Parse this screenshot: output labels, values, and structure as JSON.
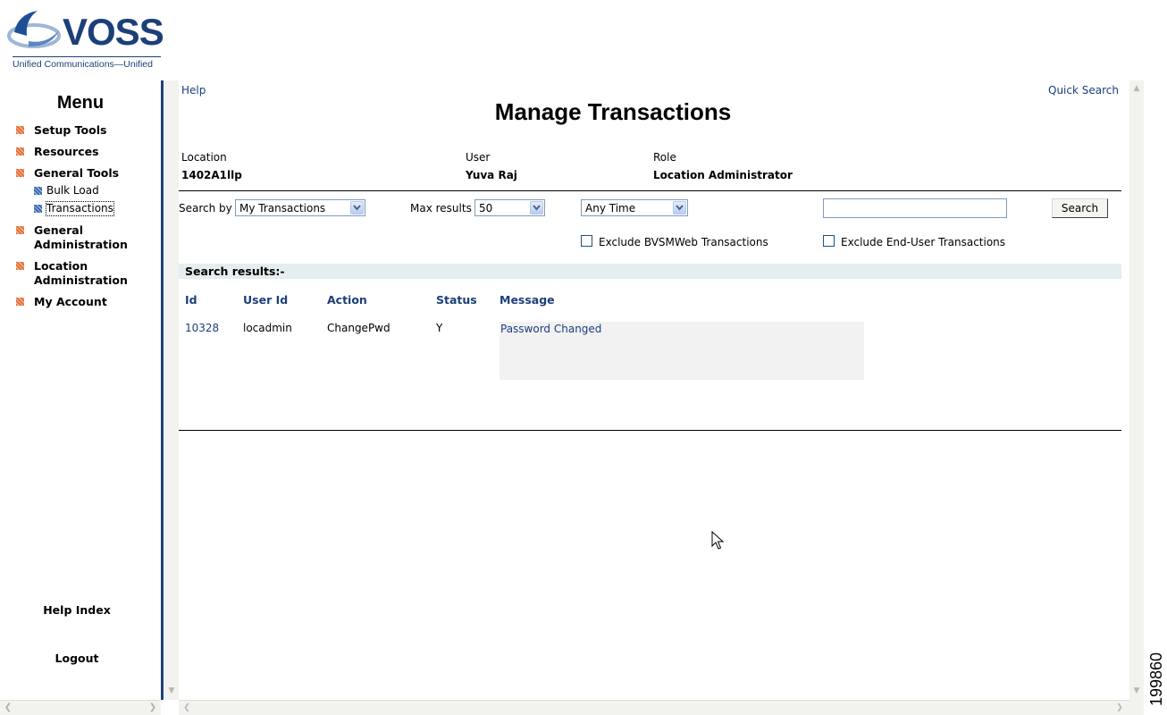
{
  "logo": {
    "brand": "VOSS",
    "tagline": "Unified Communications—Unified"
  },
  "menu": {
    "title": "Menu",
    "items": [
      {
        "label": "Setup Tools"
      },
      {
        "label": "Resources"
      },
      {
        "label": "General Tools"
      },
      {
        "label": "General Administration"
      },
      {
        "label": "Location Administration"
      },
      {
        "label": "My Account"
      }
    ],
    "subitems": [
      {
        "label": "Bulk Load"
      },
      {
        "label": "Transactions"
      }
    ],
    "help_index": "Help Index",
    "logout": "Logout"
  },
  "header": {
    "help": "Help",
    "quick_search": "Quick Search",
    "title": "Manage Transactions"
  },
  "info": {
    "location_label": "Location",
    "location_value": "1402A1llp",
    "user_label": "User",
    "user_value": "Yuva Raj",
    "role_label": "Role",
    "role_value": "Location Administrator"
  },
  "search": {
    "search_by_label": "Search by",
    "search_by_value": "My Transactions",
    "max_results_label": "Max results",
    "max_results_value": "50",
    "time_value": "Any Time",
    "query_value": "",
    "button": "Search",
    "exclude_bvsm": "Exclude BVSMWeb Transactions",
    "exclude_enduser": "Exclude End-User Transactions",
    "exclude_bvsm_checked": false,
    "exclude_enduser_checked": false
  },
  "results": {
    "heading": "Search results:-",
    "columns": [
      "Id",
      "User Id",
      "Action",
      "Status",
      "Message"
    ],
    "rows": [
      {
        "id": "10328",
        "user_id": "locadmin",
        "action": "ChangePwd",
        "status": "Y",
        "message": "Password Changed"
      }
    ]
  },
  "figure_number": "199860",
  "colors": {
    "accent": "#1c3f7a",
    "menu_bullet": "#e07040",
    "sub_bullet": "#3a6ab0"
  }
}
